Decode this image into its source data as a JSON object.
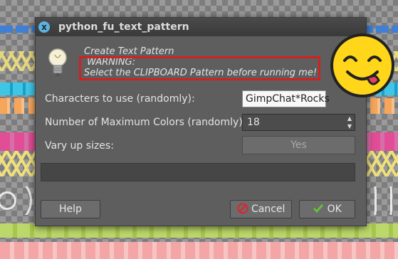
{
  "window": {
    "title": "python_fu_text_pattern",
    "close_glyph": "x"
  },
  "message": {
    "line1": "Create Text Pattern",
    "line2": " WARNING:",
    "line3": "Select the CLIPBOARD Pattern before running me!"
  },
  "form": {
    "chars_label": "Characters to use (randomly):",
    "chars_value": "GimpChat*Rocks",
    "colors_label": "Number of Maximum Colors (randomly):",
    "colors_value": "18",
    "sizes_label": "Vary up sizes:",
    "sizes_toggle": "Yes"
  },
  "buttons": {
    "help": "Help",
    "cancel": "Cancel",
    "ok": "OK"
  },
  "colors": {
    "warning_border": "#d12222",
    "smiley_face": "#ffd61a",
    "dialog_bg": "#5e5e5e"
  },
  "icons": [
    "close-icon",
    "lightbulb-icon",
    "spin-up-icon",
    "spin-down-icon",
    "cancel-icon",
    "checkmark-icon",
    "smiley-emoji"
  ]
}
